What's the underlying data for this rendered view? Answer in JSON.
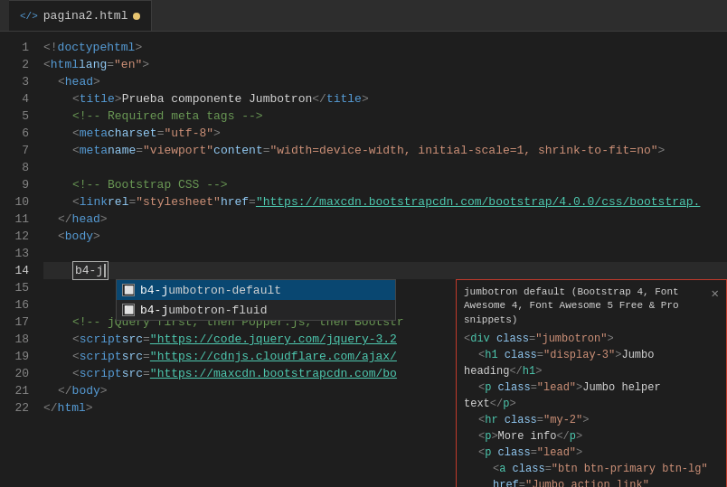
{
  "tab": {
    "filename": "pagina2.html",
    "modified": true
  },
  "lines": [
    {
      "num": 1,
      "content": "html"
    },
    {
      "num": 2,
      "content": "html_lang"
    },
    {
      "num": 3,
      "content": "head_open"
    },
    {
      "num": 4,
      "content": "title"
    },
    {
      "num": 5,
      "content": "comment_meta"
    },
    {
      "num": 6,
      "content": "meta_charset"
    },
    {
      "num": 7,
      "content": "meta_viewport"
    },
    {
      "num": 8,
      "content": "blank"
    },
    {
      "num": 9,
      "content": "comment_bootstrap"
    },
    {
      "num": 10,
      "content": "link_bootstrap"
    },
    {
      "num": 11,
      "content": "head_close"
    },
    {
      "num": 12,
      "content": "body_open"
    },
    {
      "num": 13,
      "content": "blank2"
    },
    {
      "num": 14,
      "content": "typed_b4j"
    },
    {
      "num": 15,
      "content": "autocomplete_1"
    },
    {
      "num": 16,
      "content": "autocomplete_2"
    },
    {
      "num": 17,
      "content": "comment_jquery"
    },
    {
      "num": 18,
      "content": "script_jquery"
    },
    {
      "num": 19,
      "content": "script_cloudflare"
    },
    {
      "num": 20,
      "content": "script_bootstrap"
    },
    {
      "num": 21,
      "content": "body_close"
    },
    {
      "num": 22,
      "content": "html_close"
    }
  ],
  "autocomplete": {
    "items": [
      {
        "label": "b4-jumbotron-default",
        "selected": true
      },
      {
        "label": "b4-jumbotron-fluid",
        "selected": false
      }
    ]
  },
  "preview": {
    "title": "jumbotron default (Bootstrap 4, Font Awesome 4, Font Awesome 5 Free & Pro snippets)",
    "close": "✕",
    "code_lines": [
      {
        "text": "<div class=\"jumbotron\">"
      },
      {
        "text": "    <h1 class=\"display-3\">Jumbo heading</h1>"
      },
      {
        "text": "    <p class=\"lead\">Jumbo helper text</p>"
      },
      {
        "text": "    <hr class=\"my-2\">"
      },
      {
        "text": "    <p>More info</p>"
      },
      {
        "text": "    <p class=\"lead\">"
      },
      {
        "text": "        <a class=\"btn btn-primary btn-lg\""
      },
      {
        "text": "href=\"Jumbo_action_link\""
      }
    ]
  },
  "colors": {
    "accent_red": "#c0392b",
    "selection_blue": "#094771",
    "editor_bg": "#1e1e1e"
  }
}
